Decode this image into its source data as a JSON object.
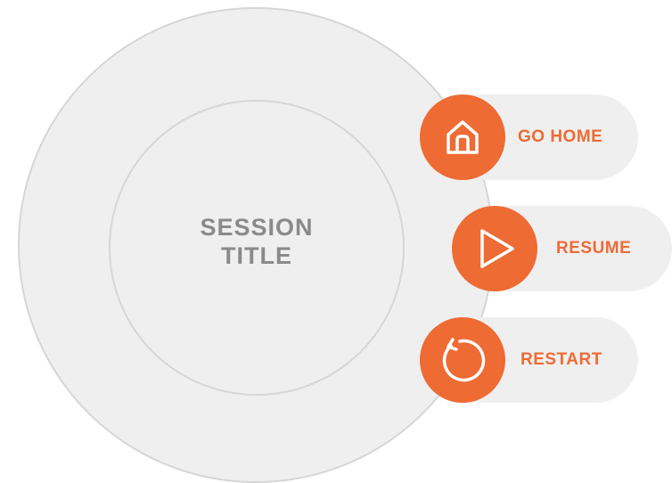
{
  "session": {
    "title_line1": "SESSION",
    "title_line2": "TITLE"
  },
  "menu": {
    "items": [
      {
        "label": "GO HOME",
        "icon": "home-icon"
      },
      {
        "label": "RESUME",
        "icon": "play-icon"
      },
      {
        "label": "RESTART",
        "icon": "restart-icon"
      }
    ]
  },
  "colors": {
    "accent": "#ee6b34",
    "circle_fill": "#efefef",
    "circle_border": "#d6d6d6",
    "title_text": "#8a8a8a",
    "background": "#ffffff"
  }
}
